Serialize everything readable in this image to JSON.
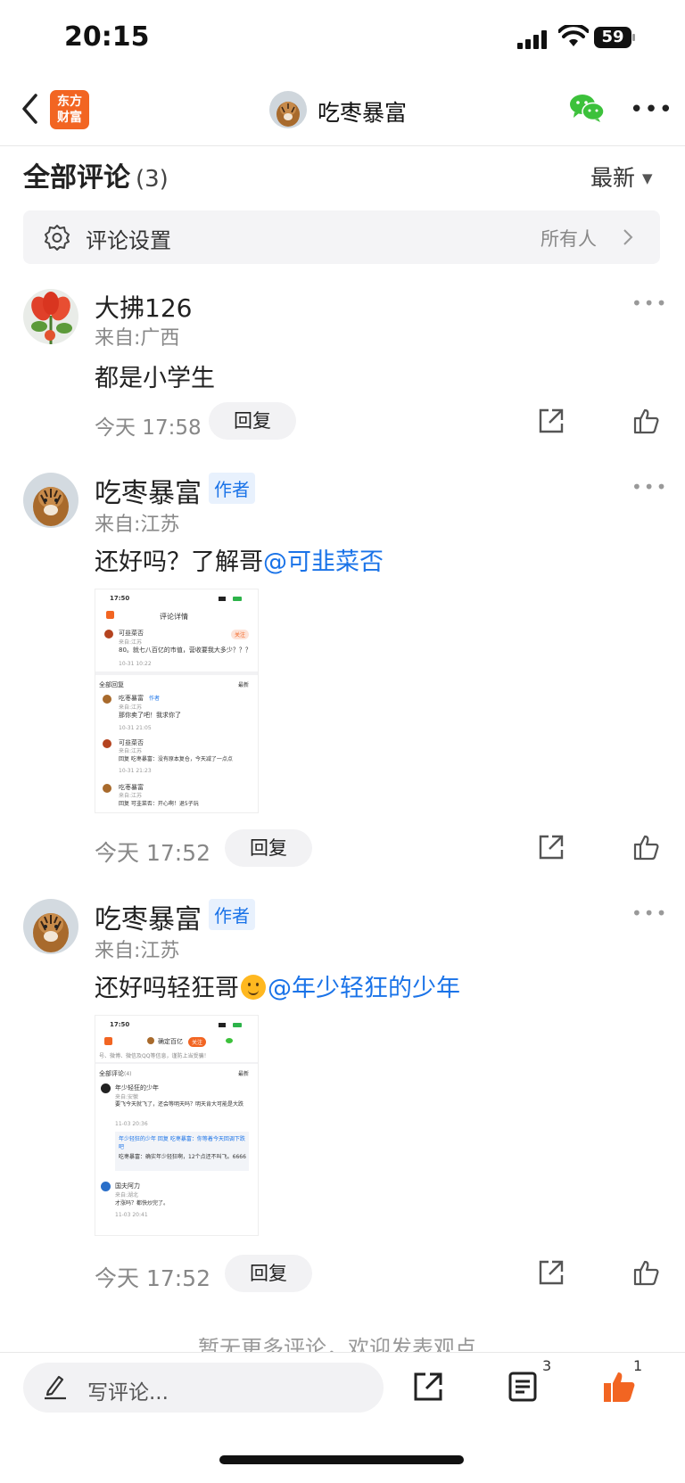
{
  "status_bar": {
    "time": "20:15",
    "battery": "59"
  },
  "nav": {
    "logo_line1": "东方",
    "logo_line2": "财富",
    "title": "吃枣暴富"
  },
  "comments_header": {
    "title": "全部评论",
    "count": "(3)",
    "sort_label": "最新"
  },
  "settings": {
    "label": "评论设置",
    "value": "所有人"
  },
  "comments": [
    {
      "username": "大拂126",
      "location": "来自:广西",
      "text": "都是小学生",
      "time": "今天 17:58",
      "reply_label": "回复"
    },
    {
      "username": "吃枣暴富",
      "badge": "作者",
      "location": "来自:江苏",
      "text": "还好吗？了解哥",
      "mention": "@可韭菜否",
      "time": "今天 17:52",
      "reply_label": "回复"
    },
    {
      "username": "吃枣暴富",
      "badge": "作者",
      "location": "来自:江苏",
      "text": "还好吗轻狂哥",
      "mention": "@年少轻狂的少年",
      "time": "今天 17:52",
      "reply_label": "回复"
    }
  ],
  "shot1": {
    "time": "17:50",
    "title": "评论详情",
    "name1": "可韭菜否",
    "follow": "关注",
    "loc1": "来自:江苏",
    "text1": "80。就七八百亿的市值，营收要我大多少？？？",
    "t1": "10-31 10:22",
    "section": "全部回复",
    "sort": "最新",
    "name2": "吃枣暴富",
    "badge": "作者",
    "loc2": "来自:江苏",
    "text2": "那你卖了吧！我求你了",
    "t2": "10-31 21:05",
    "name3": "可韭菜否",
    "loc3": "来自:江苏",
    "text3": "回复 吃枣暴富：没有原本复仓，今天减了一点点",
    "t3": "10-31 21:23",
    "name4": "吃枣暴富",
    "loc4": "来自:江苏",
    "text4": "回复 可韭菜否：开心啊！退5子玩"
  },
  "shot2": {
    "time": "17:50",
    "title": "确定百亿",
    "follow": "关注",
    "banner": "号、微博、微信及QQ等信息，谨防上当受骗！",
    "section": "全部评论",
    "count": "(4)",
    "sort": "最新",
    "name1": "年少轻狂的少年",
    "loc1": "来自:安徽",
    "text1": "要飞今天就飞了，还会等明天吗？明天肯大可能是大跌",
    "t1": "11-03 20:36",
    "reply1": "年少轻狂的少年 回复 吃枣暴富：你等着今天回调下跌吧",
    "reply2": "吃枣暴富：确实年少轻狂啊，12个点还不叫飞。6666",
    "name2": "国夫阿力",
    "loc2": "来自:湖北",
    "text2": "才涨吗？都快炒完了。",
    "t2": "11-03 20:41"
  },
  "footer": {
    "no_more": "暂无更多评论，欢迎发表观点"
  },
  "bottom_bar": {
    "placeholder": "写评论...",
    "comments_count": "3",
    "likes_count": "1"
  },
  "colors": {
    "accent": "#f26522",
    "link": "#1a73e8",
    "wechat": "#3cc13b"
  }
}
